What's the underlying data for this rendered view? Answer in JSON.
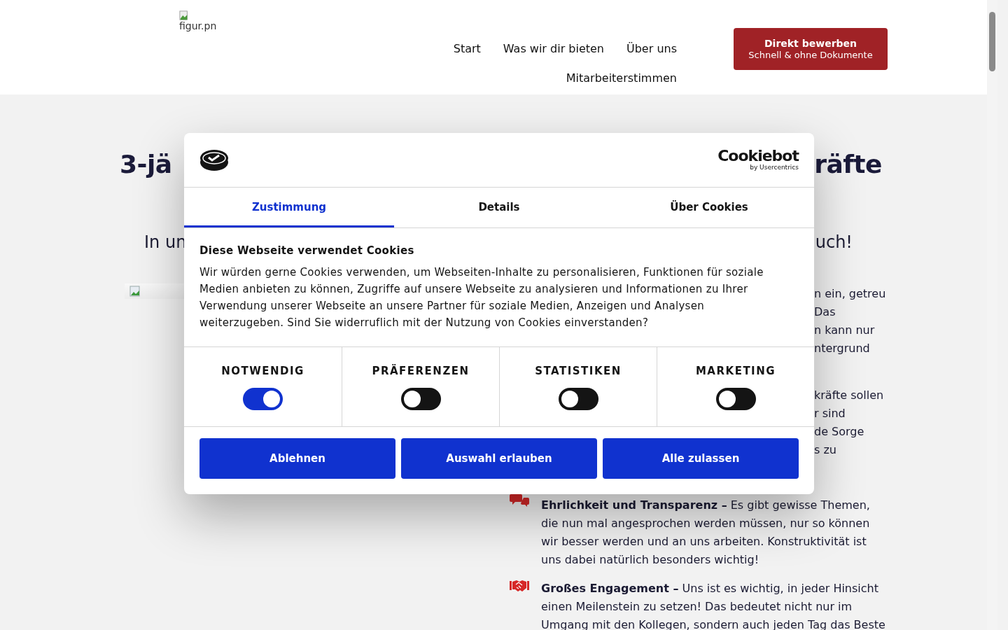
{
  "header": {
    "logo_alt": "figur.pn",
    "nav": [
      {
        "label": "Start"
      },
      {
        "label": "Was wir dir bieten"
      },
      {
        "label": "Über uns"
      },
      {
        "label": "Mitarbeiterstimmen"
      }
    ],
    "cta": {
      "title": "Direkt bewerben",
      "subtitle": "Schnell & ohne Dokumente"
    }
  },
  "page": {
    "heading_fragments": [
      "3-jä",
      "räfte"
    ],
    "intro_fragments": [
      "In un",
      "uch!"
    ],
    "text_fragments": [
      [
        "n ein, getreu",
        "Das",
        "n kann nur",
        "ntergrund"
      ],
      [
        "kräfte sollen",
        "r sind",
        "de Sorge",
        "s zu"
      ]
    ],
    "values": [
      {
        "kind": "speech",
        "text": "**Ehrlichkeit und Transparenz –** Es gibt gewisse Themen, die nun mal angesprochen werden müssen, nur so können wir besser werden und an uns arbeiten. Konstruktivität ist uns dabei natürlich besonders wichtig!"
      },
      {
        "kind": "handshake",
        "text": "**Großes Engagement –** Uns ist es wichtig, in jeder Hinsicht einen Meilenstein zu setzen! Das bedeutet nicht nur im Umgang mit den Kollegen, sondern auch jeden Tag das Beste"
      }
    ]
  },
  "cookie_dialog": {
    "brand": "Cookiebot",
    "brand_sub": "by Usercentrics",
    "tabs": [
      {
        "label": "Zustimmung",
        "selected": true
      },
      {
        "label": "Details",
        "selected": false
      },
      {
        "label": "Über Cookies",
        "selected": false
      }
    ],
    "title": "Diese Webseite verwendet Cookies",
    "text": "Wir würden gerne Cookies verwenden, um Webseiten-Inhalte zu personalisieren, Funktionen für soziale Medien anbieten zu können, Zugriffe auf unsere Webseite zu analysieren und Informationen zu Ihrer Verwendung unserer Webseite an unsere Partner für soziale Medien, Anzeigen und Analysen weiterzugeben. Sind Sie widerruflich mit der Nutzung von Cookies einverstanden?",
    "categories": [
      {
        "label": "NOTWENDIG",
        "on": true
      },
      {
        "label": "PRÄFERENZEN",
        "on": false
      },
      {
        "label": "STATISTIKEN",
        "on": false
      },
      {
        "label": "MARKETING",
        "on": false
      }
    ],
    "buttons": [
      "Ablehnen",
      "Auswahl erlauben",
      "Alle zulassen"
    ]
  }
}
